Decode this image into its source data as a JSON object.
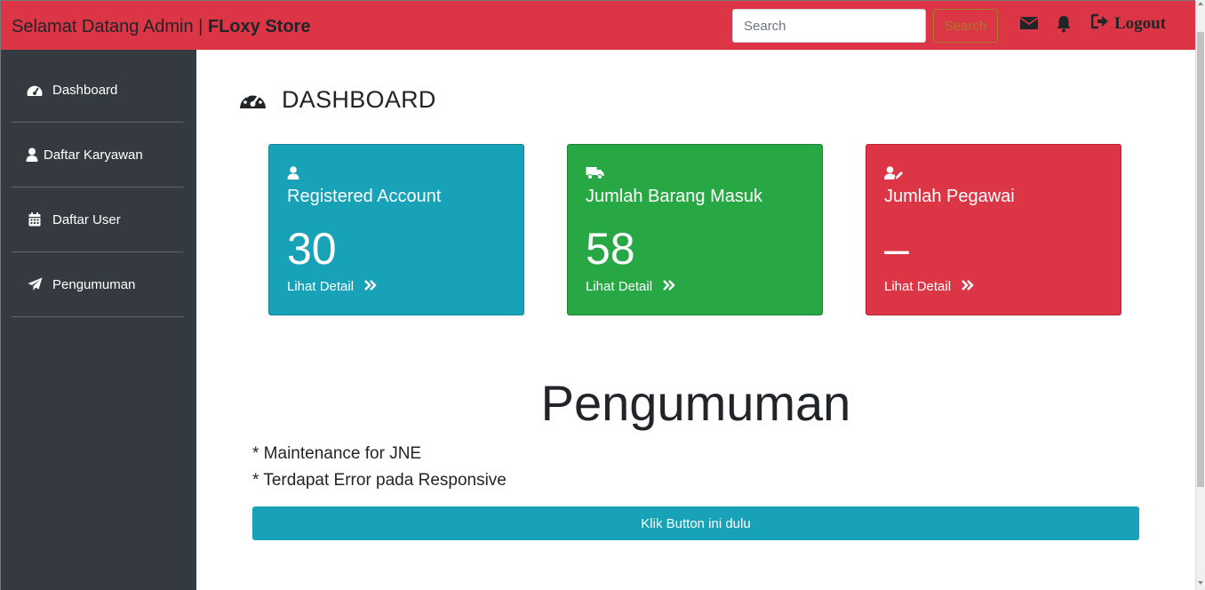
{
  "header": {
    "brand_greeting": "Selamat Datang Admin | ",
    "brand_store": "FLoxy Store",
    "search_placeholder": "Search",
    "search_button": "Search",
    "logout_label": "Logout",
    "icons": [
      "envelope-icon",
      "bell-icon",
      "sign-out-icon"
    ]
  },
  "sidebar": {
    "items": [
      {
        "label": "Dashboard",
        "icon": "tachometer-icon"
      },
      {
        "label": "Daftar Karyawan",
        "icon": "user-icon"
      },
      {
        "label": "Daftar User",
        "icon": "calendar-icon"
      },
      {
        "label": "Pengumuman",
        "icon": "paper-plane-icon"
      }
    ]
  },
  "main": {
    "title": "DASHBOARD",
    "cards": [
      {
        "title": "Registered Account",
        "value": "30",
        "link": "Lihat Detail",
        "color": "#17a2b8",
        "icon": "user-icon"
      },
      {
        "title": "Jumlah Barang Masuk",
        "value": "58",
        "link": "Lihat Detail",
        "color": "#28a745",
        "icon": "truck-icon"
      },
      {
        "title": "Jumlah Pegawai",
        "value": "–",
        "link": "Lihat Detail",
        "color": "#dc3545",
        "icon": "user-edit-icon"
      }
    ],
    "announcement": {
      "title": "Pengumuman",
      "items": [
        "* Maintenance for JNE",
        "* Terdapat Error pada Responsive"
      ],
      "button": "Klik Button ini dulu"
    }
  },
  "colors": {
    "navbar": "#dc3545",
    "sidebar": "#343a40",
    "info": "#17a2b8",
    "success": "#28a745",
    "danger": "#dc3545"
  }
}
